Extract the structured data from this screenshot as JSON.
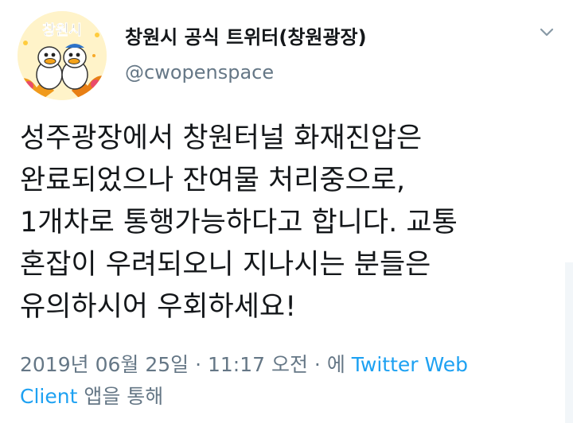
{
  "user": {
    "display_name": "창원시 공식 트위터(창원광장)",
    "handle": "@cwopenspace",
    "avatar_text": "창원시"
  },
  "tweet": {
    "lines": [
      "성주광장에서 창원터널 화재진압은",
      "완료되었으나 잔여물 처리중으로,",
      "1개차로 통행가능하다고 합니다. 교통",
      "혼잡이 우려되오니 지나시는 분들은",
      "유의하시어 우회하세요!"
    ]
  },
  "meta": {
    "timestamp": "2019년 06월 25일 · 11:17 오전 · 에",
    "source_line1": "Twitter Web",
    "source_line2": "Client",
    "suffix": "앱을 통해"
  },
  "icons": {
    "menu": "chevron-down-icon"
  },
  "colors": {
    "text": "#14171a",
    "secondary": "#657786",
    "link": "#1da1f2"
  }
}
